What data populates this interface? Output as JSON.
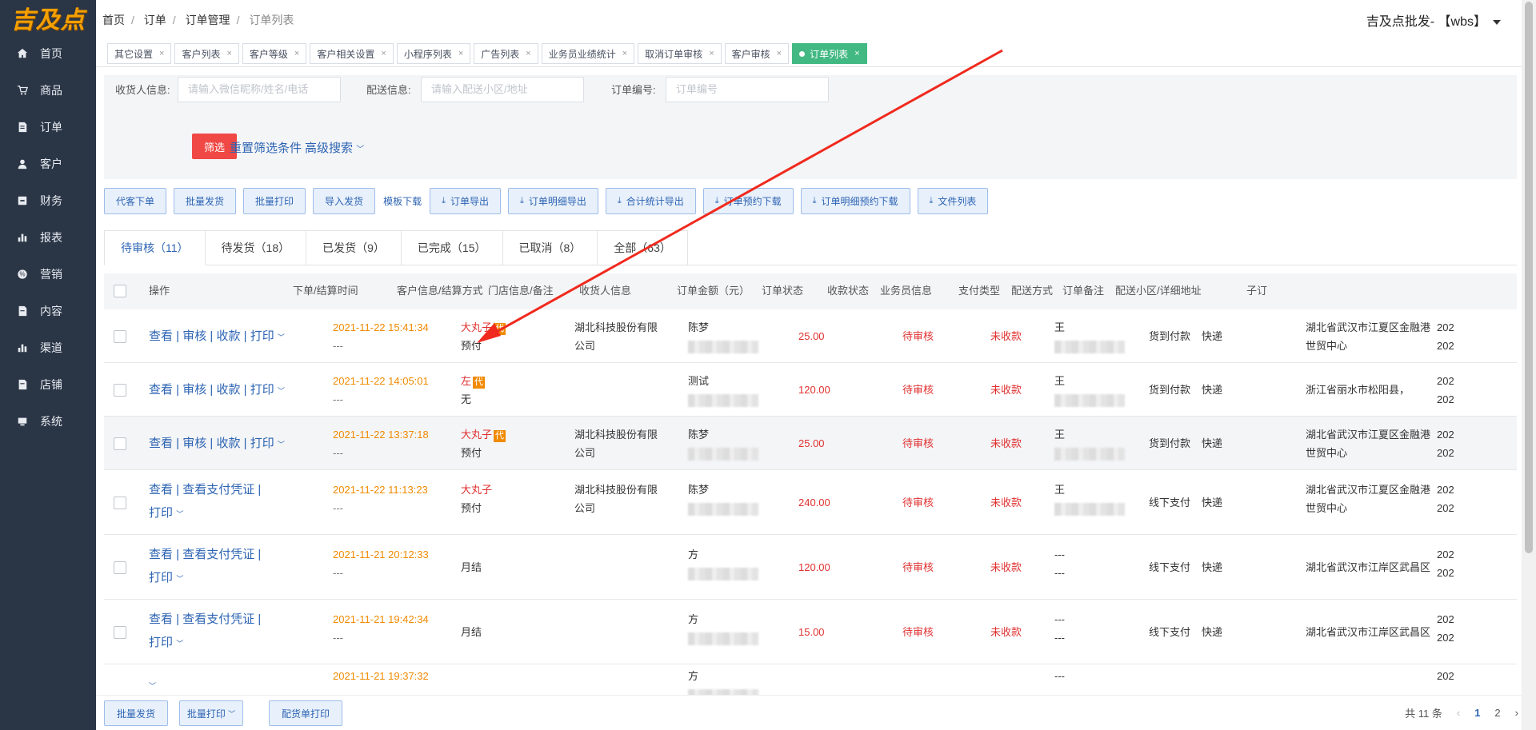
{
  "logo": "吉及点",
  "sidebar": {
    "items": [
      {
        "label": "首页",
        "icon": "home-icon"
      },
      {
        "label": "商品",
        "icon": "cart-icon"
      },
      {
        "label": "订单",
        "icon": "order-icon"
      },
      {
        "label": "客户",
        "icon": "user-icon"
      },
      {
        "label": "财务",
        "icon": "finance-icon"
      },
      {
        "label": "报表",
        "icon": "chart-icon"
      },
      {
        "label": "营销",
        "icon": "marketing-icon"
      },
      {
        "label": "内容",
        "icon": "content-icon"
      },
      {
        "label": "渠道",
        "icon": "channel-icon"
      },
      {
        "label": "店铺",
        "icon": "store-icon"
      },
      {
        "label": "系统",
        "icon": "system-icon"
      }
    ]
  },
  "breadcrumb": [
    "首页",
    "订单",
    "订单管理",
    "订单列表"
  ],
  "user": "吉及点批发- 【wbs】",
  "tabs": [
    "其它设置",
    "客户列表",
    "客户等级",
    "客户相关设置",
    "小程序列表",
    "广告列表",
    "业务员业绩统计",
    "取消订单审核",
    "客户审核",
    "订单列表"
  ],
  "filter": {
    "receiver_label": "收货人信息:",
    "receiver_placeholder": "请输入微信昵称/姓名/电话",
    "delivery_label": "配送信息:",
    "delivery_placeholder": "请输入配送小区/地址",
    "order_label": "订单编号:",
    "order_placeholder": "订单编号",
    "filter_btn": "筛选",
    "reset": "重置筛选条件",
    "advanced": "高级搜索"
  },
  "actions": [
    "代客下单",
    "批量发货",
    "批量打印",
    "导入发货"
  ],
  "template_download": "模板下载",
  "exports": [
    "订单导出",
    "订单明细导出",
    "合计统计导出",
    "订单预约下载",
    "订单明细预约下载",
    "文件列表"
  ],
  "status_tabs": [
    "待审核（11）",
    "待发货（18）",
    "已发货（9）",
    "已完成（15）",
    "已取消（8）",
    "全部（63）"
  ],
  "columns": [
    "操作",
    "下单/结算时间",
    "客户信息/结算方式",
    "门店信息/备注",
    "收货人信息",
    "订单金额（元）",
    "订单状态",
    "收款状态",
    "业务员信息",
    "支付类型",
    "配送方式",
    "订单备注",
    "配送小区/详细地址",
    "子订"
  ],
  "rows": [
    {
      "ops1": "查看 | 审核 | 收款 | 打印",
      "ops2": "",
      "time": "2021-11-22 15:41:34",
      "time2": "---",
      "customer": "大丸子",
      "tag": "代",
      "settle": "预付",
      "store1": "湖北科技股份有限",
      "store2": "公司",
      "receiver": "陈梦",
      "amount": "25.00",
      "status": "待审核",
      "pay": "未收款",
      "sales": "王",
      "ptype": "货到付款",
      "ship": "快递",
      "addr1": "湖北省武汉市江夏区金融港",
      "addr2": "世贸中心",
      "sub1": "202",
      "sub2": "202"
    },
    {
      "ops1": "查看 | 审核 | 收款 | 打印",
      "ops2": "",
      "time": "2021-11-22 14:05:01",
      "time2": "---",
      "customer": "左",
      "tag": "代",
      "settle": "无",
      "store1": "",
      "store2": "",
      "receiver": "测试",
      "amount": "120.00",
      "status": "待审核",
      "pay": "未收款",
      "sales": "王",
      "ptype": "货到付款",
      "ship": "快递",
      "addr1": "浙江省丽水市松阳县，",
      "addr2": "",
      "sub1": "202",
      "sub2": "202"
    },
    {
      "ops1": "查看 | 审核 | 收款 | 打印",
      "ops2": "",
      "time": "2021-11-22 13:37:18",
      "time2": "---",
      "customer": "大丸子",
      "tag": "代",
      "settle": "预付",
      "store1": "湖北科技股份有限",
      "store2": "公司",
      "receiver": "陈梦",
      "amount": "25.00",
      "status": "待审核",
      "pay": "未收款",
      "sales": "王",
      "ptype": "货到付款",
      "ship": "快递",
      "addr1": "湖北省武汉市江夏区金融港",
      "addr2": "世贸中心",
      "sub1": "202",
      "sub2": "202"
    },
    {
      "ops1": "查看 | 查看支付凭证 |",
      "ops2": "打印",
      "time": "2021-11-22 11:13:23",
      "time2": "---",
      "customer": "大丸子",
      "tag": "",
      "settle": "预付",
      "store1": "湖北科技股份有限",
      "store2": "公司",
      "receiver": "陈梦",
      "amount": "240.00",
      "status": "待审核",
      "pay": "未收款",
      "sales": "王",
      "ptype": "线下支付",
      "ship": "快递",
      "addr1": "湖北省武汉市江夏区金融港",
      "addr2": "世贸中心",
      "sub1": "202",
      "sub2": "202"
    },
    {
      "ops1": "查看 | 查看支付凭证 |",
      "ops2": "打印",
      "time": "2021-11-21 20:12:33",
      "time2": "---",
      "customer": "",
      "tag": "",
      "settle": "月结",
      "store1": "",
      "store2": "",
      "receiver": "方",
      "amount": "120.00",
      "status": "待审核",
      "pay": "未收款",
      "sales": "---",
      "sales2": "---",
      "ptype": "线下支付",
      "ship": "快递",
      "addr1": "湖北省武汉市江岸区武昌区",
      "addr2": "",
      "sub1": "202",
      "sub2": "202"
    },
    {
      "ops1": "查看 | 查看支付凭证 |",
      "ops2": "打印",
      "time": "2021-11-21 19:42:34",
      "time2": "---",
      "customer": "",
      "tag": "",
      "settle": "月结",
      "store1": "",
      "store2": "",
      "receiver": "方",
      "amount": "15.00",
      "status": "待审核",
      "pay": "未收款",
      "sales": "---",
      "sales2": "---",
      "ptype": "线下支付",
      "ship": "快递",
      "addr1": "湖北省武汉市江岸区武昌区",
      "addr2": "",
      "sub1": "202",
      "sub2": "202"
    },
    {
      "ops1": "",
      "ops2": "",
      "time": "2021-11-21 19:37:32",
      "time2": "",
      "customer": "",
      "tag": "",
      "settle": "",
      "store1": "",
      "store2": "",
      "receiver": "方",
      "amount": "",
      "status": "",
      "pay": "",
      "sales": "---",
      "ptype": "",
      "ship": "",
      "addr1": "",
      "addr2": "",
      "sub1": "202",
      "sub2": ""
    }
  ],
  "footer": {
    "buttons": [
      "批量发货",
      "批量打印",
      "配货单打印"
    ],
    "total": "共 11 条",
    "pages": [
      "1",
      "2"
    ]
  },
  "colors": {
    "sidebar": "#2a3546",
    "accent": "#2d64b3",
    "active_tab": "#42b983",
    "danger": "#e03030",
    "time": "#f08a00"
  }
}
